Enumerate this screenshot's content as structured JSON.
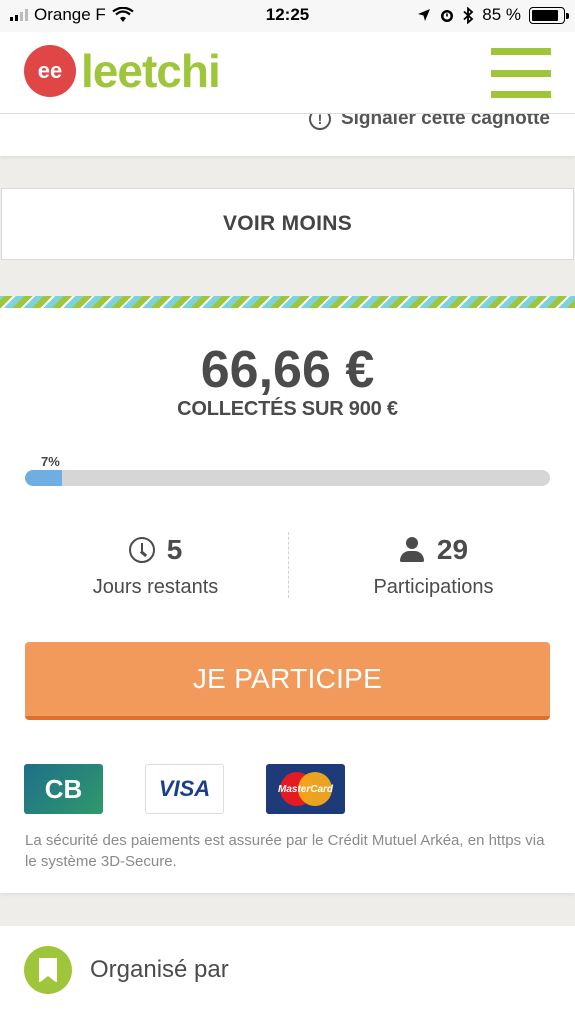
{
  "status_bar": {
    "carrier": "Orange F",
    "time": "12:25",
    "battery": "85 %",
    "battery_level": 0.85
  },
  "header": {
    "logo_badge": "ee",
    "logo_text": "leetchi"
  },
  "report": {
    "label": "Signaler cette cagnotte"
  },
  "voir_moins": {
    "label": "VOIR MOINS"
  },
  "fundraiser": {
    "amount": "66,66 €",
    "collected_label": "COLLECTÉS SUR 900 €",
    "progress_label": "7%",
    "progress_fraction": 0.07,
    "days_value": "5",
    "days_label": "Jours restants",
    "participants_value": "29",
    "participants_label": "Participations",
    "cta_label": "JE PARTICIPE",
    "payment_cards": {
      "cb": "CB",
      "visa": "VISA",
      "mastercard": "MasterCard"
    },
    "security_text": "La sécurité des paiements est assurée par le Crédit Mutuel Arkéa, en https via le système 3D-Secure."
  },
  "organizer": {
    "label": "Organisé par"
  },
  "colors": {
    "brand_green": "#9fc63b",
    "brand_red": "#e04646",
    "cta_orange": "#f29a5c",
    "progress_blue": "#6eaee0"
  }
}
